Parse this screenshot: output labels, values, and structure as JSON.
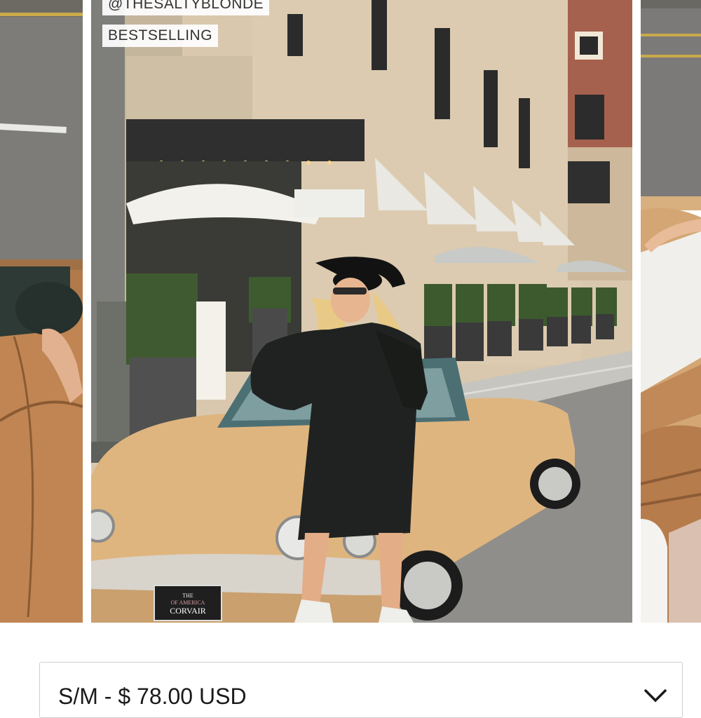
{
  "product_gallery": {
    "handle_tag": "@THESALTYBLONDE",
    "badge_tag": "BESTSELLING",
    "plate_text": "CORVAIR",
    "plate_subtext": "OF AMERICA",
    "plate_heading": "THE"
  },
  "variant_select": {
    "selected_label": "S/M - $ 78.00 USD",
    "icon": "chevron-down-icon"
  }
}
